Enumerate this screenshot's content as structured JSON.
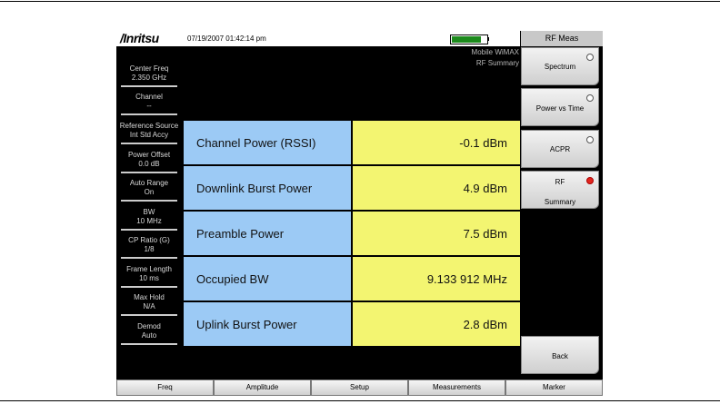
{
  "header": {
    "logo": "/Inritsu",
    "timestamp": "07/19/2007 01:42:14 pm"
  },
  "mode": {
    "line1": "Mobile WiMAX",
    "line2": "RF Summary"
  },
  "params": [
    {
      "name": "center-freq",
      "label": "Center Freq",
      "value": "2.350 GHz"
    },
    {
      "name": "channel",
      "label": "Channel",
      "value": "--"
    },
    {
      "name": "reference-source",
      "label": "Reference Source",
      "value": "Int Std Accy"
    },
    {
      "name": "power-offset",
      "label": "Power Offset",
      "value": "0.0 dB"
    },
    {
      "name": "auto-range",
      "label": "Auto Range",
      "value": "On"
    },
    {
      "name": "bw",
      "label": "BW",
      "value": "10 MHz"
    },
    {
      "name": "cp-ratio",
      "label": "CP Ratio (G)",
      "value": "1/8"
    },
    {
      "name": "frame-length",
      "label": "Frame Length",
      "value": "10 ms"
    },
    {
      "name": "max-hold",
      "label": "Max Hold",
      "value": "N/A"
    },
    {
      "name": "demod",
      "label": "Demod",
      "value": "Auto"
    }
  ],
  "measurements": [
    {
      "label": "Channel Power (RSSI)",
      "value": "-0.1 dBm"
    },
    {
      "label": "Downlink Burst Power",
      "value": "4.9 dBm"
    },
    {
      "label": "Preamble Power",
      "value": "7.5 dBm"
    },
    {
      "label": "Occupied BW",
      "value": "9.133 912 MHz"
    },
    {
      "label": "Uplink Burst Power",
      "value": "2.8 dBm"
    }
  ],
  "softkeys": {
    "title": "RF Meas",
    "spectrum": "Spectrum",
    "power_vs_time": "Power vs Time",
    "acpr": "ACPR",
    "rf_summary_1": "RF",
    "rf_summary_2": "Summary",
    "back": "Back",
    "active_color": "#e3261e"
  },
  "bottom_menu": [
    "Freq",
    "Amplitude",
    "Setup",
    "Measurements",
    "Marker"
  ]
}
